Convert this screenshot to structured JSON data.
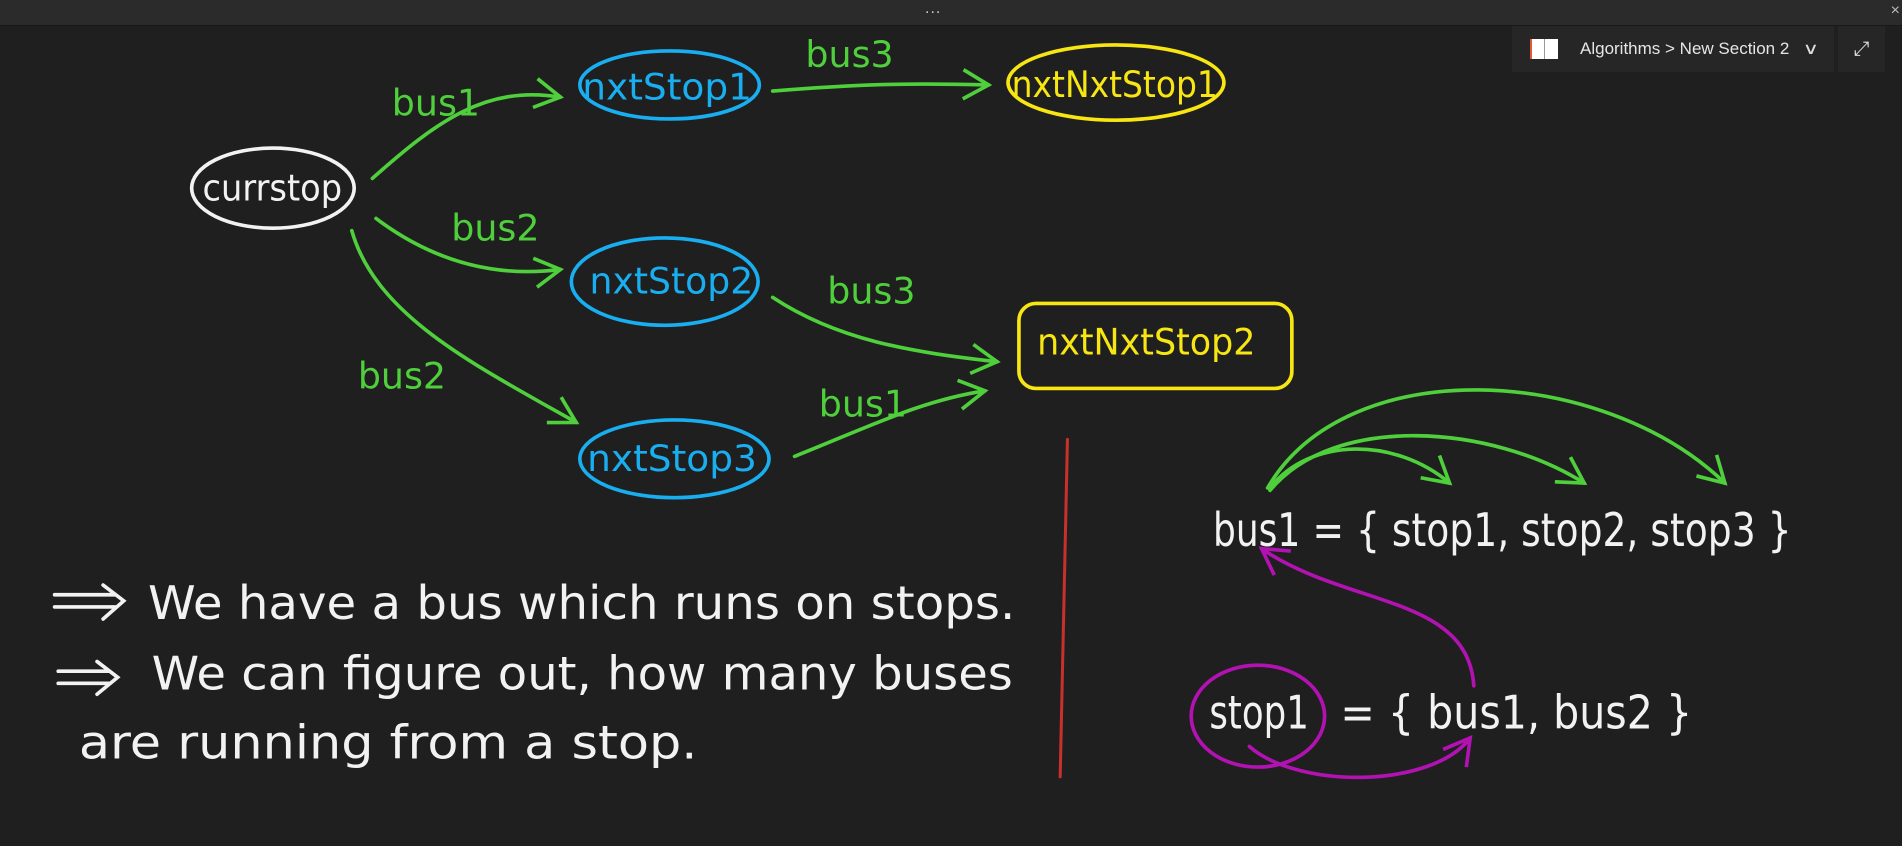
{
  "window": {
    "menu_dots": "...",
    "close": "×"
  },
  "notebook": {
    "breadcrumb": "Algorithms > New Section 2",
    "expand_icon": "expand-icon"
  },
  "diagram": {
    "nodes": {
      "curr": "currstop",
      "n1": "nxtStop1",
      "n2": "nxtStop2",
      "n3": "nxtStop3",
      "nn1": "nxtNxtStop1",
      "nn2": "nxtNxtStop2"
    },
    "edges": {
      "c_n1": "bus1",
      "n1_nn1": "bus3",
      "c_n2": "bus2",
      "n2_nn2": "bus3",
      "c_n3": "bus2",
      "n3_nn2": "bus1"
    }
  },
  "notes": {
    "line1": "We have a bus which runs on stops.",
    "line2": "We can figure out, how many buses",
    "line3": "are running from a stop."
  },
  "mapping": {
    "bus_label": "bus1",
    "bus_set": "= { stop1,  stop2,  stop3 }",
    "stop_label": "stop1",
    "stop_set": "= { bus1,  bus2 }"
  },
  "colors": {
    "bg": "#1f1f1f",
    "green": "#4fcf3c",
    "blue": "#19aef0",
    "yellow": "#f7e612",
    "red": "#c8302c",
    "magenta": "#b312b3"
  }
}
